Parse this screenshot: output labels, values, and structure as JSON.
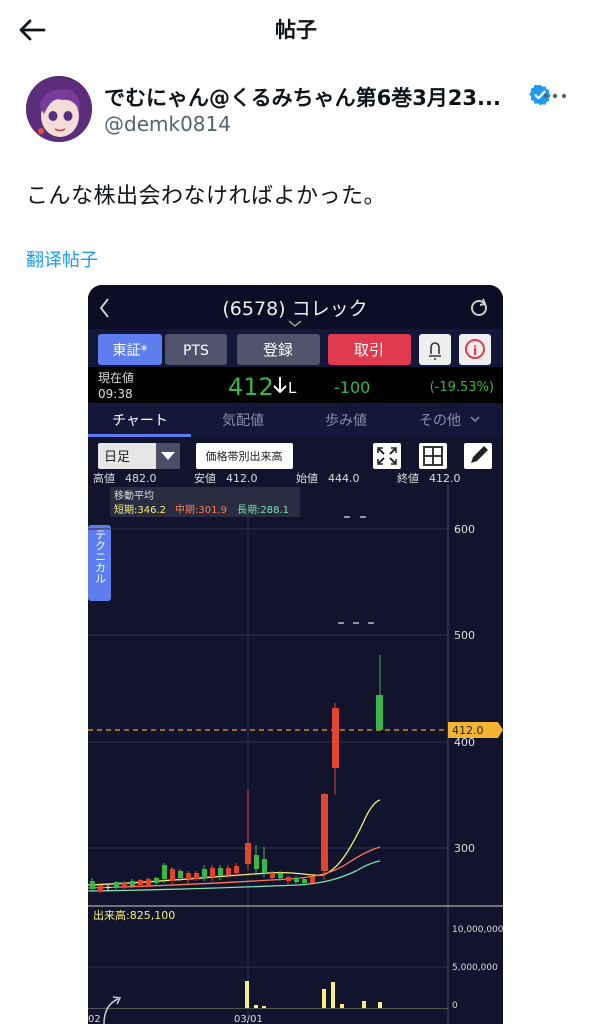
{
  "header": {
    "title": "帖子"
  },
  "post": {
    "display_name": "でむにゃん@くるみちゃん第6巻3月23...",
    "handle": "@demk0814",
    "text": "こんな株出会わなければよかった。",
    "translate_label": "翻译帖子"
  },
  "stock_app": {
    "title": "(6578) コレック",
    "buttons": {
      "market": "東証*",
      "pts": "PTS",
      "register": "登録",
      "trade": "取引"
    },
    "price_label": "現在値",
    "time": "09:38",
    "price": "412",
    "price_suffix": "L",
    "change": "-100",
    "change_pct": "(-19.53%)",
    "tabs": [
      "チャート",
      "気配値",
      "歩み値",
      "その他"
    ],
    "period": "日足",
    "band_button": "価格帯別出来高",
    "ohlc": [
      {
        "label": "高値",
        "value": "482.0"
      },
      {
        "label": "安値",
        "value": "412.0"
      },
      {
        "label": "始値",
        "value": "444.0"
      },
      {
        "label": "終値",
        "value": "412.0"
      }
    ],
    "ma_title": "移動平均",
    "ma": [
      {
        "label": "短期:346.2",
        "color": "#f5f07a"
      },
      {
        "label": "中期:301.9",
        "color": "#ff7b52"
      },
      {
        "label": "長期:288.1",
        "color": "#7fe0b0"
      }
    ],
    "side_tab": "テクニカル",
    "price_ticks": [
      "600",
      "500",
      "400",
      "300"
    ],
    "current_marker": "412.0",
    "volume_label": "出来高:825,100",
    "volume_ticks": [
      "10,000,000",
      "5,000,000",
      "0"
    ],
    "date_labels": [
      "02",
      "03/01"
    ],
    "colors": {
      "up": "#39b54a",
      "down": "#e0452e",
      "accent": "#1d9bf0"
    }
  }
}
